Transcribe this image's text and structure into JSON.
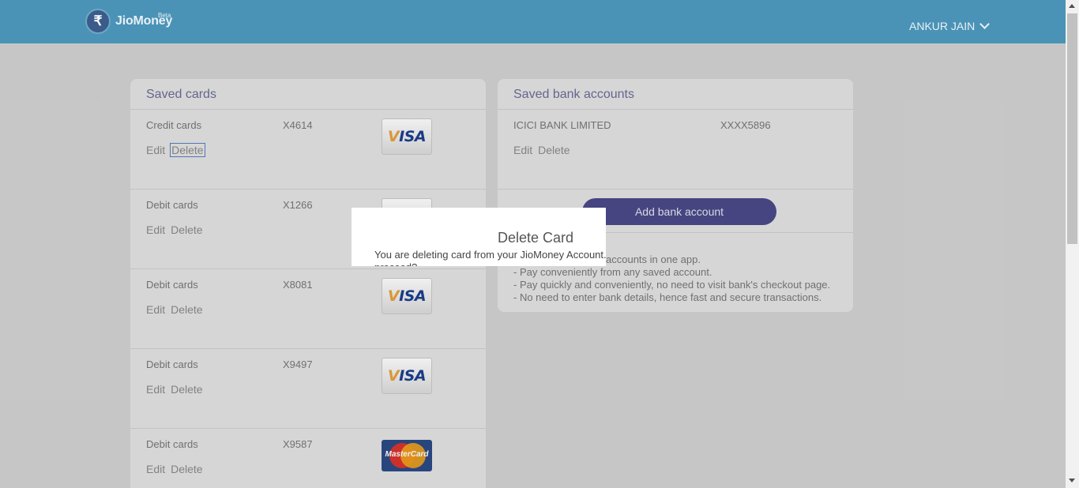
{
  "header": {
    "logo_symbol": "₹",
    "logo_text": "JioMoney",
    "logo_badge": "Beta",
    "user_name": "ANKUR JAIN"
  },
  "saved_cards": {
    "title": "Saved cards",
    "edit_label": "Edit",
    "delete_label": "Delete",
    "cards": [
      {
        "type": "Credit cards",
        "number": "X4614",
        "brand": "VISA"
      },
      {
        "type": "Debit cards",
        "number": "X1266",
        "brand": ""
      },
      {
        "type": "Debit cards",
        "number": "X8081",
        "brand": "VISA"
      },
      {
        "type": "Debit cards",
        "number": "X9497",
        "brand": "VISA"
      },
      {
        "type": "Debit cards",
        "number": "X9587",
        "brand": "MasterCard"
      }
    ]
  },
  "saved_bank_accounts": {
    "title": "Saved bank accounts",
    "bank_name": "ICICI BANK LIMITED",
    "account_number": "XXXX5896",
    "edit_label": "Edit",
    "delete_label": "Delete",
    "add_button_label": "Add bank account",
    "benefits": [
      "accounts in one app.",
      "- Pay conveniently from any saved account.",
      "- Pay quickly and conveniently, no need to visit bank's checkout page.",
      "- No need to enter bank details, hence fast and secure transactions."
    ]
  },
  "modal": {
    "title": "Delete Card",
    "message": "You are deleting card from your JioMoney Account. proceed?"
  },
  "colors": {
    "header_bg": "#4a93b6",
    "accent_button": "#4b4a8a",
    "panel_title": "#6a6d96"
  }
}
